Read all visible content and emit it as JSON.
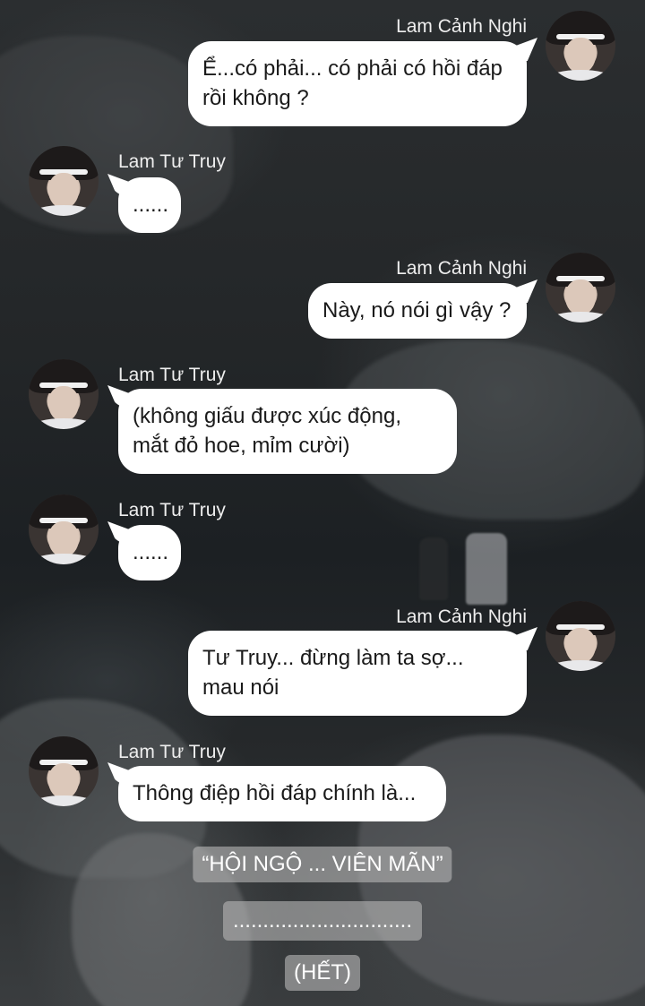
{
  "messages": [
    {
      "sender": "Lam Cảnh Nghi",
      "text": "Ể...có phải... có phải có hồi đáp rồi không ?"
    },
    {
      "sender": "Lam Tư Truy",
      "text": "......"
    },
    {
      "sender": "Lam Cảnh Nghi",
      "text": "Này, nó nói gì vậy ?"
    },
    {
      "sender": "Lam Tư Truy",
      "text": "(không giấu được xúc động,\nmắt đỏ hoe, mỉm cười)"
    },
    {
      "sender": "Lam Tư Truy",
      "text": "......"
    },
    {
      "sender": "Lam Cảnh Nghi",
      "text": "Tư Truy... đừng làm ta sợ...\nmau nói"
    },
    {
      "sender": "Lam Tư Truy",
      "text": "Thông điệp hồi đáp chính là..."
    }
  ],
  "footer_notes": [
    "“HỘI NGỘ ... VIÊN MÃN”",
    "..............................",
    "(HẾT)"
  ]
}
